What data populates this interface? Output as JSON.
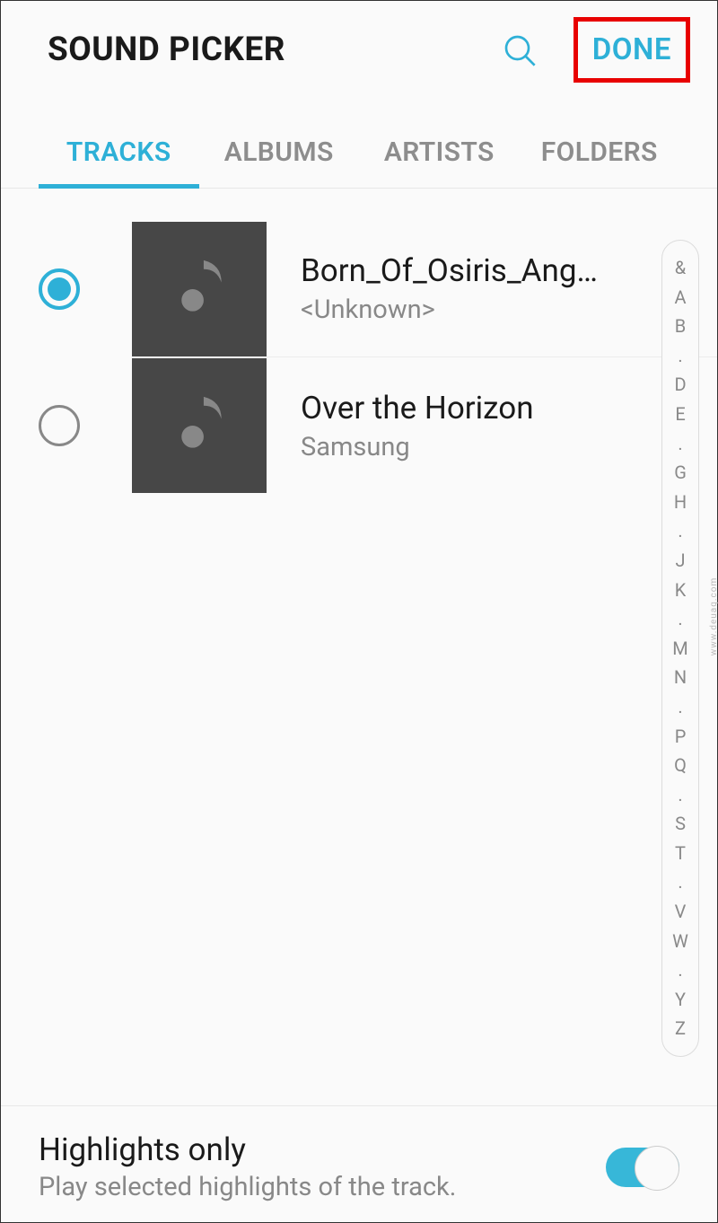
{
  "header": {
    "title": "SOUND PICKER",
    "done_label": "DONE"
  },
  "tabs": [
    {
      "label": "TRACKS",
      "active": true
    },
    {
      "label": "ALBUMS",
      "active": false
    },
    {
      "label": "ARTISTS",
      "active": false
    },
    {
      "label": "FOLDERS",
      "active": false
    }
  ],
  "tracks": [
    {
      "title": "Born_Of_Osiris_Ang…",
      "artist": "<Unknown>",
      "selected": true
    },
    {
      "title": "Over the Horizon",
      "artist": "Samsung",
      "selected": false
    }
  ],
  "index_letters": [
    "&",
    "A",
    "B",
    ".",
    "D",
    "E",
    ".",
    "G",
    "H",
    ".",
    "J",
    "K",
    ".",
    "M",
    "N",
    ".",
    "P",
    "Q",
    ".",
    "S",
    "T",
    ".",
    "V",
    "W",
    ".",
    "Y",
    "Z"
  ],
  "footer": {
    "title": "Highlights only",
    "subtitle": "Play selected highlights of the track.",
    "toggle_on": true
  },
  "watermark": "www.deuaq.com"
}
